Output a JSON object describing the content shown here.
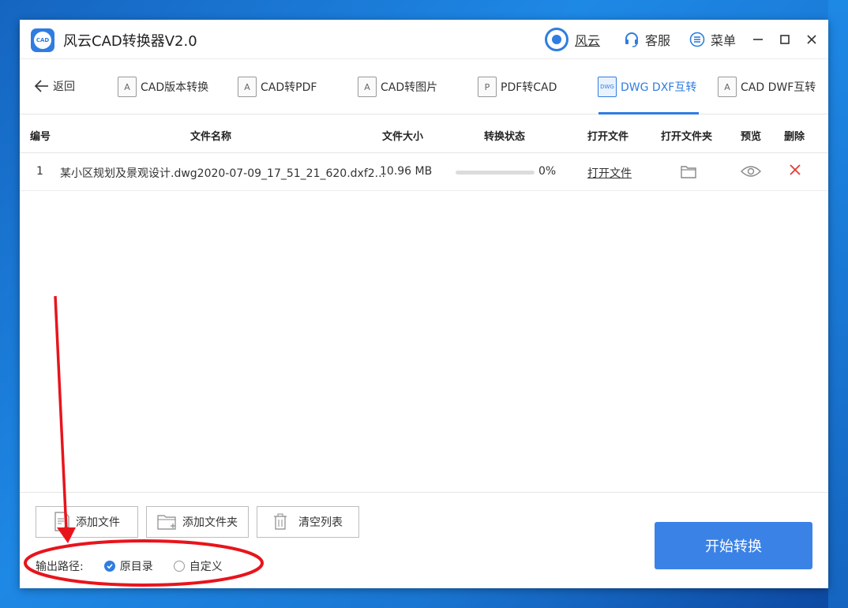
{
  "window": {
    "title": "风云CAD转换器V2.0",
    "logo_text": "CAD"
  },
  "titlebar": {
    "user_label": "风云",
    "service_label": "客服",
    "menu_label": "菜单"
  },
  "toolbar": {
    "back_label": "返回",
    "tabs": [
      {
        "label": "CAD版本转换",
        "icon": "A"
      },
      {
        "label": "CAD转PDF",
        "icon": "A"
      },
      {
        "label": "CAD转图片",
        "icon": "A"
      },
      {
        "label": "PDF转CAD",
        "icon": "P"
      },
      {
        "label": "DWG DXF互转",
        "icon": "DWG"
      },
      {
        "label": "CAD DWF互转",
        "icon": "A"
      }
    ],
    "active_tab": 4
  },
  "table": {
    "headers": [
      "编号",
      "文件名称",
      "文件大小",
      "转换状态",
      "打开文件",
      "打开文件夹",
      "预览",
      "删除"
    ],
    "rows": [
      {
        "index": "1",
        "filename": "某小区规划及景观设计.dwg2020-07-09_17_51_21_620.dxf2...",
        "size": "10.96 MB",
        "progress": 0,
        "progress_text": "0%",
        "open_file": "打开文件"
      }
    ]
  },
  "bottom": {
    "add_file_label": "添加文件",
    "add_folder_label": "添加文件夹",
    "clear_label": "清空列表",
    "output_label": "输出路径:",
    "option_original": "原目录",
    "option_custom": "自定义",
    "selected_option": "原目录",
    "start_label": "开始转换"
  },
  "colors": {
    "accent": "#2f7de1",
    "start_button": "#3b82e6",
    "delete": "#e53935",
    "annotation": "#e8141c"
  }
}
